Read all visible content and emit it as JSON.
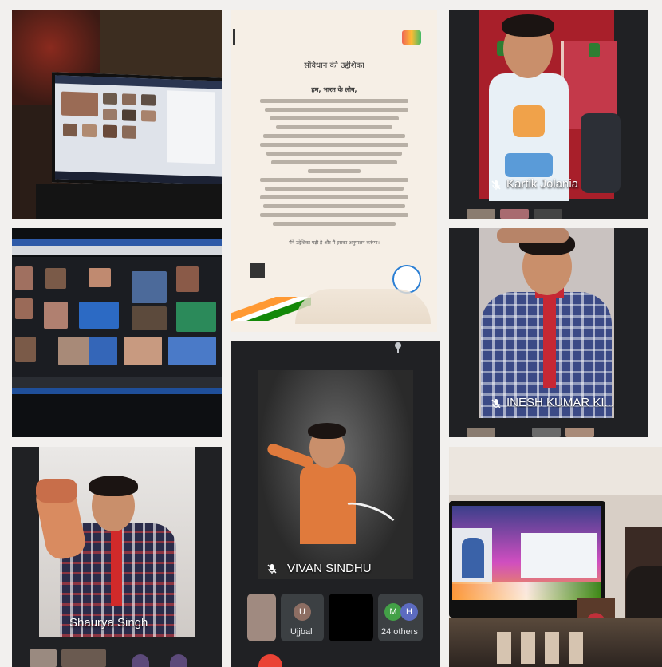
{
  "collage": {
    "doc_title": "संविधान की उद्देशिका",
    "doc_heading": "हम, भारत के लोग,",
    "doc_footer_line": "मैंने उद्देशिका पढ़ी है और मैं इसका अनुपालन करूंगा।"
  },
  "participants": {
    "kartik": "Kartik Jolania",
    "inesh": "INESH KUMAR KI...",
    "shaurya": "Shaurya Singh",
    "vivan": "VIVAN SINDHU",
    "ujjbal": "Ujjbal",
    "others": "24 others"
  },
  "avatars": {
    "u": "U",
    "m": "M",
    "h": "H"
  },
  "colors": {
    "meet_dark": "#202124",
    "avatar_u": "#8d6e63",
    "avatar_m": "#43a047",
    "avatar_h": "#5c6bc0"
  }
}
